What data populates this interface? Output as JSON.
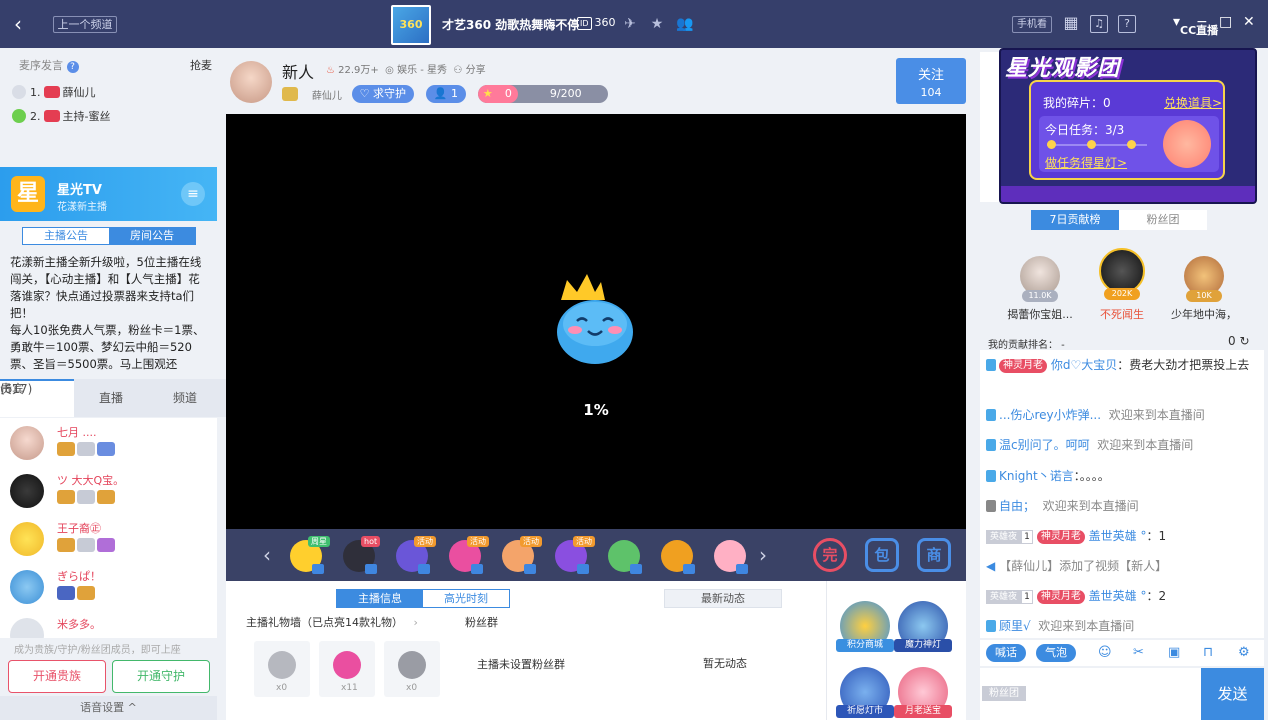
{
  "topbar": {
    "prev_channel": "上一个频道",
    "channel_logo_text": "360",
    "channel_title": "才艺360 劲歌热舞嗨不停",
    "id_badge": "ID",
    "channel_id": "360",
    "phone_watch": "手机看",
    "cc_logo": "CC直播"
  },
  "left": {
    "seat_header": "麦序发言",
    "grab": "抢麦",
    "seats": [
      {
        "rank": "1.",
        "name": "薛仙儿"
      },
      {
        "rank": "2.",
        "name": "主持-蜜丝"
      }
    ],
    "channel_name": "星光TV",
    "channel_sub": "花漾新主播",
    "logo_char": "星",
    "notice_tabs": [
      "主播公告",
      "房间公告"
    ],
    "notice_text": [
      "花漾新主播全新升级啦，5位主播在线闯关，【心动主播】和【人气主播】花落谁家？快点通过投票器来支持ta们把！",
      "每人10张免费人气票，粉丝卡＝1票、勇敢牛＝100票、梦幻云中船＝520票、圣旨＝5500票。马上围观还"
    ],
    "user_tabs": {
      "guests": "贵宾",
      "guests_count": "(617)",
      "mics": "直播",
      "channel": "频道"
    },
    "users": [
      {
        "name": "七月 ...."
      },
      {
        "name": "ツ 大大Q宝。"
      },
      {
        "name": "王子裔㊣"
      },
      {
        "name": "ぎらぱ！"
      },
      {
        "name": "米多多。"
      }
    ],
    "note": "成为贵族/守护/粉丝团成员，即可上座",
    "btn_noble": "开通贵族",
    "btn_guard": "开通守护",
    "voice_settings": "语音设置 ^"
  },
  "host": {
    "name": "新人",
    "heat": "22.9万+",
    "category": "娱乐 - 星秀",
    "share": "分享",
    "owner": "薛仙儿",
    "guard_btn": "求守护",
    "guard_count": "1",
    "star_count": "0",
    "star_progress": "9/200",
    "follow_label": "关注",
    "follow_count": "104"
  },
  "video": {
    "loading": "1%"
  },
  "gifts": [
    {
      "tag": "周星"
    },
    {
      "tag": "hot"
    },
    {
      "tag": "活动"
    },
    {
      "tag": "活动"
    },
    {
      "tag": "活动"
    },
    {
      "tag": "活动"
    },
    {
      "tag": ""
    },
    {
      "tag": ""
    },
    {
      "tag": ""
    }
  ],
  "info": {
    "tabs": [
      "主播信息",
      "高光时刻"
    ],
    "latest": "最新动态",
    "gift_wall": "主播礼物墙（已点亮14款礼物）",
    "fans_group": "粉丝群",
    "wall_gifts": [
      {
        "count": "x0"
      },
      {
        "count": "x11"
      },
      {
        "count": "x0"
      }
    ],
    "no_fans": "主播未设置粉丝群",
    "no_news": "暂无动态",
    "acts": [
      "积分商城",
      "魔力神灯",
      "祈愿灯市",
      "月老送宝"
    ]
  },
  "promo": {
    "title": "星光观影团",
    "shards": "我的碎片：0",
    "redeem": "兑换道具>",
    "task": "今日任务：3/3",
    "task_link": "做任务得星灯>"
  },
  "rank": {
    "tabs": [
      "7日贡献榜",
      "粉丝团"
    ],
    "top": [
      {
        "value": "11.0K",
        "name": "揭蕾你宝姐..."
      },
      {
        "value": "202K",
        "name": "不死闻生"
      },
      {
        "value": "10K",
        "name": "少年地中海，"
      }
    ],
    "my_rank_label": "我的贡献排名：  -",
    "my_rank_value": "0"
  },
  "chat": [
    {
      "badge": "神灵月老",
      "user": "你d♡大宝贝",
      "text": "：费老大劲才把票投上去"
    },
    {
      "user": "...伤心rey小炸弹...",
      "text": "欢迎来到本直播间"
    },
    {
      "user": "温c别问了。呵呵",
      "text": "欢迎来到本直播间"
    },
    {
      "user": "Knight丶诺言",
      "text": "：。。。。"
    },
    {
      "user": "自由；",
      "text": "欢迎来到本直播间"
    },
    {
      "fan": "英雄夜",
      "lv": "1",
      "badge": "神灵月老",
      "user": "盖世英雄 °",
      "text": "：1"
    },
    {
      "text": "【薛仙儿】添加了视频【新人】"
    },
    {
      "fan": "英雄夜",
      "lv": "1",
      "badge": "神灵月老",
      "user": "盖世英雄 °",
      "text": "：2"
    },
    {
      "user": "顾里√",
      "text": "欢迎来到本直播间"
    }
  ],
  "chat_tools": {
    "shout": "喊话",
    "bubble": "气泡"
  },
  "input": {
    "fan_tag": "粉丝团",
    "send": "发送"
  },
  "colors": {
    "topbar": "#363f6b",
    "accent": "#3c8be0",
    "noble": "#e8536a",
    "guard": "#43b86b"
  }
}
